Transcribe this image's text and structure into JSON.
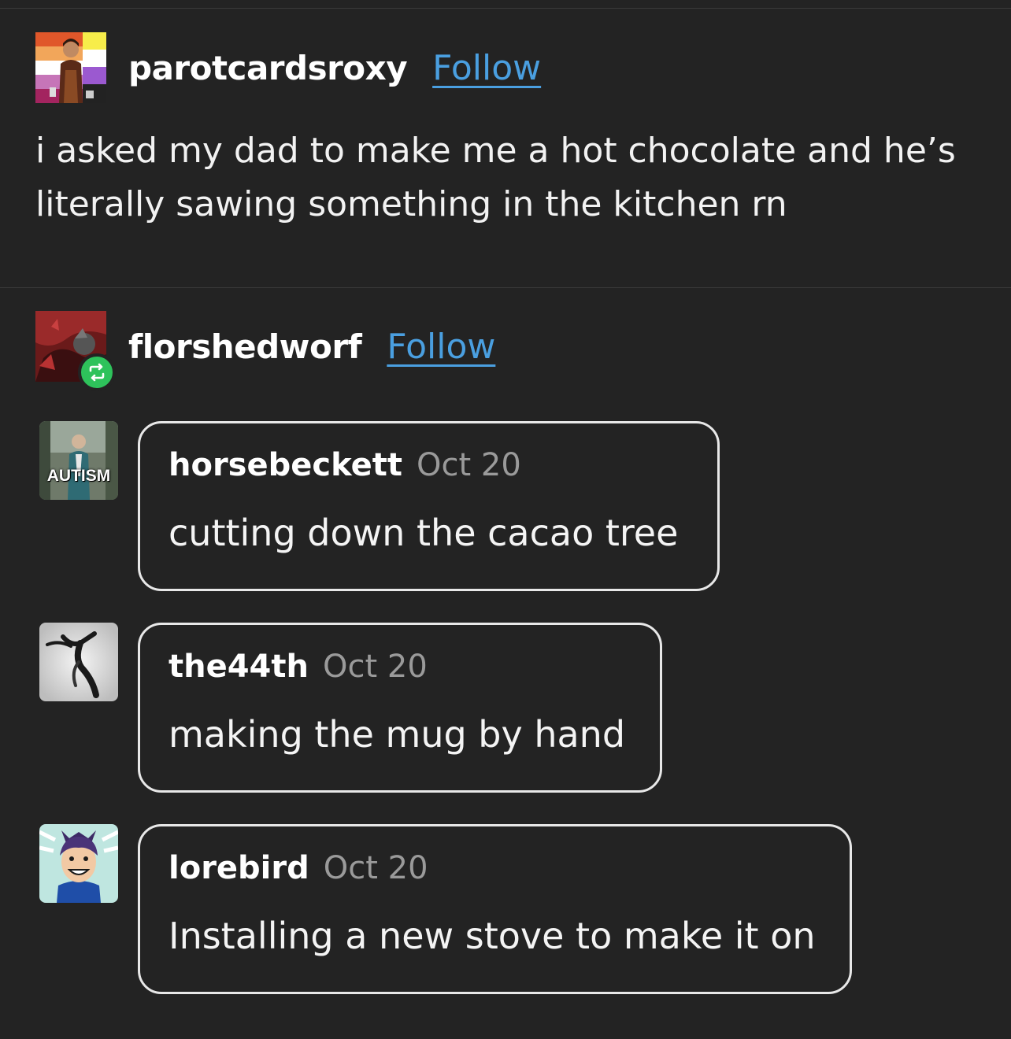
{
  "op": {
    "username": "parotcardsroxy",
    "follow_label": "Follow",
    "body": "i asked my dad to make me a hot chocolate and he’s literally sawing something in the kitchen rn"
  },
  "reblogger": {
    "username": "florshedworf",
    "follow_label": "Follow"
  },
  "replies": [
    {
      "username": "horsebeckett",
      "date": "Oct 20",
      "text": "cutting down the cacao tree",
      "avatar_label": "AUTISM"
    },
    {
      "username": "the44th",
      "date": "Oct 20",
      "text": "making the mug by hand"
    },
    {
      "username": "lorebird",
      "date": "Oct 20",
      "text": "Installing a new stove to make it on"
    }
  ],
  "colors": {
    "background": "#232323",
    "link": "#4a9fe0",
    "reblog_badge": "#2ec25b",
    "date_text": "#9a9a9a"
  }
}
